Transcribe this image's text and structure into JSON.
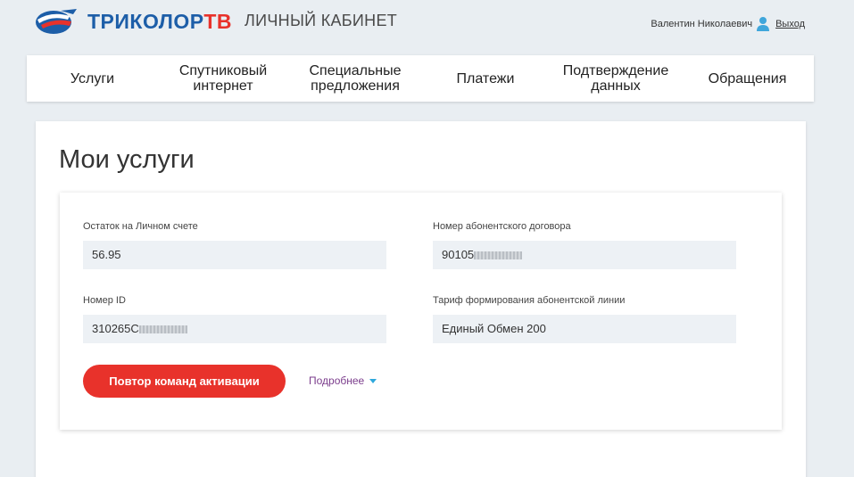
{
  "header": {
    "logo_text_main": "ТРИКОЛОР",
    "logo_text_tv": "ТВ",
    "cabinet_title": "ЛИЧНЫЙ КАБИНЕТ",
    "user_name": "Валентин Николаевич",
    "logout_label": "Выход"
  },
  "nav": {
    "items": [
      {
        "label": "Услуги"
      },
      {
        "label": "Спутниковый интернет"
      },
      {
        "label": "Специальные предложения"
      },
      {
        "label": "Платежи"
      },
      {
        "label": "Подтверждение данных"
      },
      {
        "label": "Обращения"
      }
    ]
  },
  "main": {
    "title": "Мои услуги",
    "fields": {
      "balance": {
        "label": "Остаток на Личном счете",
        "value": "56.95"
      },
      "contract": {
        "label": "Номер абонентского договора",
        "value": "90105"
      },
      "id": {
        "label": "Номер ID",
        "value": "310265C"
      },
      "tariff": {
        "label": "Тариф формирования абонентской линии",
        "value": "Единый Обмен 200"
      }
    },
    "activate_button": "Повтор команд активации",
    "more_link": "Подробнее"
  },
  "colors": {
    "brand_blue": "#1d5ea8",
    "brand_red": "#e8322b",
    "link_purple": "#7b3d8c",
    "caret_blue": "#2ea8dc"
  },
  "icons": [
    "tricolor-logo-icon",
    "user-icon",
    "caret-down-icon"
  ]
}
